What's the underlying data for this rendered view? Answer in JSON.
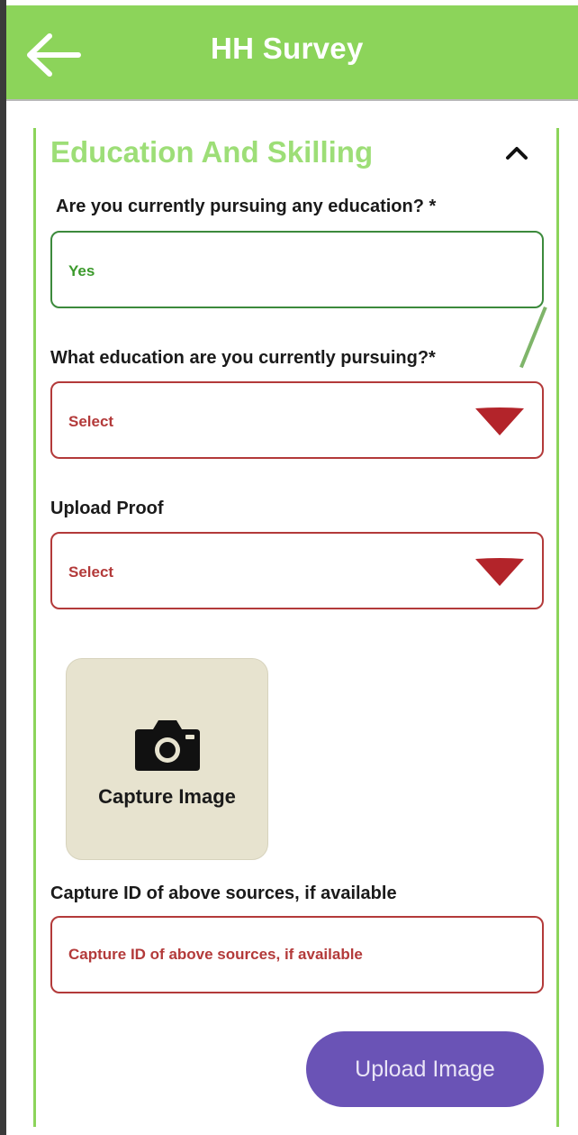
{
  "appbar": {
    "title": "HH Survey",
    "back_icon": "arrow-left-icon",
    "color": "#8cd45a"
  },
  "section": {
    "title": "Education And Skilling",
    "collapse_icon": "chevron-up-icon",
    "accent": "#9dde77"
  },
  "fields": {
    "pursuing": {
      "label": "Are you currently pursuing any education? *",
      "value": "Yes"
    },
    "education_type": {
      "label": "What education are you currently pursuing?*",
      "value": "Select",
      "icon": "caret-down-icon"
    },
    "upload_proof": {
      "label": "Upload Proof",
      "value": "Select",
      "icon": "caret-down-icon"
    }
  },
  "capture": {
    "label": "Capture Image",
    "icon": "camera-icon"
  },
  "capture_id": {
    "label": "Capture ID of above sources, if available",
    "placeholder": "Capture ID of above sources, if available"
  },
  "upload_button": {
    "label": "Upload Image",
    "color": "#6a53b6"
  },
  "colors": {
    "valid_border": "#3c8a3c",
    "error_border": "#b33a3a",
    "capture_tile": "#e7e3cf"
  }
}
